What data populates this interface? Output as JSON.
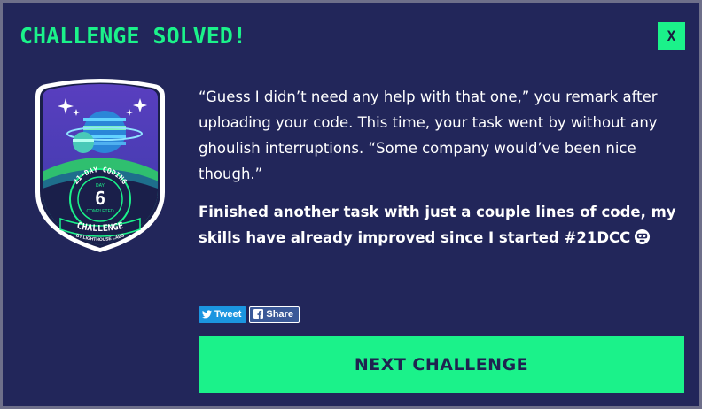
{
  "modal": {
    "title": "CHALLENGE SOLVED!",
    "close_label": "X"
  },
  "badge": {
    "arc_top": "21-DAY CODING",
    "day_label": "DAY",
    "day_number": "6",
    "completed_label": "COMPLETED",
    "challenge_label": "CHALLENGE",
    "brand": "BY LIGHTHOUSE LABS"
  },
  "content": {
    "narrative": "“Guess I didn’t need any help with that one,” you remark after uploading your code. This time, your task went by without any ghoulish interruptions. “Some company would’ve been nice though.”",
    "share_message": "Finished another task with just a couple lines of code, my skills have already improved since I started #21DCC",
    "share_emoji_icon": "robot-face-icon"
  },
  "share": {
    "tweet_label": "Tweet",
    "facebook_label": "Share"
  },
  "next_button": {
    "label": "NEXT CHALLENGE"
  },
  "colors": {
    "background": "#22265a",
    "accent": "#1bf28a",
    "twitter": "#1b95e0",
    "facebook": "#3b5998"
  }
}
